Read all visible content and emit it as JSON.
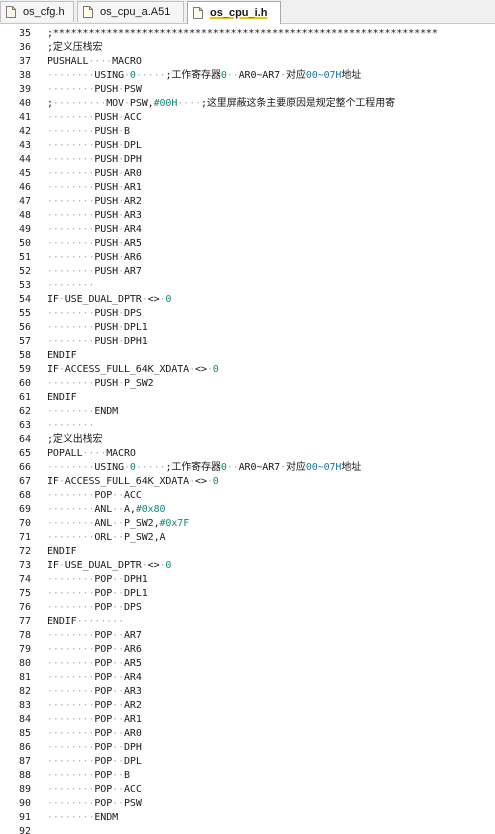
{
  "tabs": [
    {
      "label": "os_cfg.h",
      "active": false
    },
    {
      "label": "os_cpu_a.A51",
      "active": false
    },
    {
      "label": "os_cpu_i.h",
      "active": true
    }
  ],
  "editor": {
    "first_line": 35,
    "lines": [
      ";*****************************************************************",
      ";定义压栈宏",
      "PUSHALL····MACRO",
      "········USING·0·····;工作寄存器0··AR0~AR7·对应00~07H地址",
      "········PUSH·PSW",
      ";·········MOV·PSW,#00H····;这里屏蔽这条主要原因是规定整个工程用寄",
      "········PUSH·ACC",
      "········PUSH·B",
      "········PUSH·DPL",
      "········PUSH·DPH",
      "········PUSH·AR0",
      "········PUSH·AR1",
      "········PUSH·AR2",
      "········PUSH·AR3",
      "········PUSH·AR4",
      "········PUSH·AR5",
      "········PUSH·AR6",
      "········PUSH·AR7",
      "········",
      "IF·USE_DUAL_DPTR·<>·0",
      "········PUSH·DPS",
      "········PUSH·DPL1",
      "········PUSH·DPH1",
      "ENDIF",
      "IF·ACCESS_FULL_64K_XDATA·<>·0",
      "········PUSH·P_SW2",
      "ENDIF",
      "········ENDM",
      "········",
      ";定义出栈宏",
      "POPALL····MACRO",
      "········USING·0·····;工作寄存器0··AR0~AR7·对应00~07H地址",
      "IF·ACCESS_FULL_64K_XDATA·<>·0",
      "········POP··ACC",
      "········ANL··A,#0x80",
      "········ANL··P_SW2,#0x7F",
      "········ORL··P_SW2,A",
      "ENDIF",
      "IF·USE_DUAL_DPTR·<>·0",
      "········POP··DPH1",
      "········POP··DPL1",
      "········POP··DPS",
      "ENDIF········",
      "········POP··AR7",
      "········POP··AR6",
      "········POP··AR5",
      "········POP··AR4",
      "········POP··AR3",
      "········POP··AR2",
      "········POP··AR1",
      "········POP··AR0",
      "········POP··DPH",
      "········POP··DPL",
      "········POP··B",
      "········POP··ACC",
      "········POP··PSW",
      "········ENDM",
      ""
    ]
  },
  "colors": {
    "number": "#0f8a7a",
    "hex_address": "#1a7aa8",
    "whitespace_dot": "#b0b0b0"
  },
  "icons": {
    "tab_icon": "file-icon"
  }
}
